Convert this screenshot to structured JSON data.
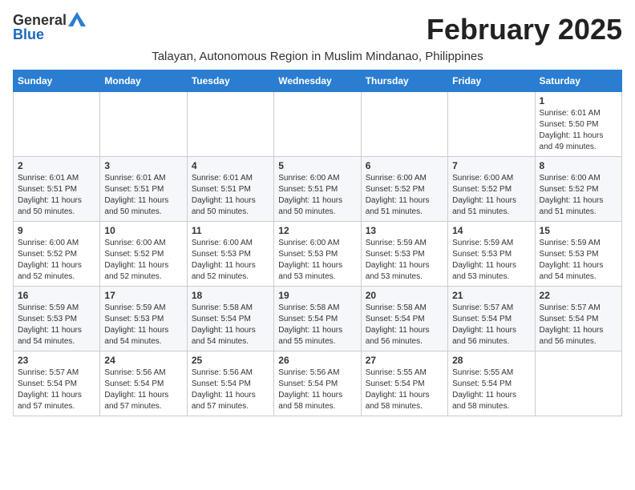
{
  "logo": {
    "general": "General",
    "blue": "Blue"
  },
  "title": "February 2025",
  "subtitle": "Talayan, Autonomous Region in Muslim Mindanao, Philippines",
  "days_of_week": [
    "Sunday",
    "Monday",
    "Tuesday",
    "Wednesday",
    "Thursday",
    "Friday",
    "Saturday"
  ],
  "weeks": [
    [
      {
        "day": "",
        "info": ""
      },
      {
        "day": "",
        "info": ""
      },
      {
        "day": "",
        "info": ""
      },
      {
        "day": "",
        "info": ""
      },
      {
        "day": "",
        "info": ""
      },
      {
        "day": "",
        "info": ""
      },
      {
        "day": "1",
        "info": "Sunrise: 6:01 AM\nSunset: 5:50 PM\nDaylight: 11 hours and 49 minutes."
      }
    ],
    [
      {
        "day": "2",
        "info": "Sunrise: 6:01 AM\nSunset: 5:51 PM\nDaylight: 11 hours and 50 minutes."
      },
      {
        "day": "3",
        "info": "Sunrise: 6:01 AM\nSunset: 5:51 PM\nDaylight: 11 hours and 50 minutes."
      },
      {
        "day": "4",
        "info": "Sunrise: 6:01 AM\nSunset: 5:51 PM\nDaylight: 11 hours and 50 minutes."
      },
      {
        "day": "5",
        "info": "Sunrise: 6:00 AM\nSunset: 5:51 PM\nDaylight: 11 hours and 50 minutes."
      },
      {
        "day": "6",
        "info": "Sunrise: 6:00 AM\nSunset: 5:52 PM\nDaylight: 11 hours and 51 minutes."
      },
      {
        "day": "7",
        "info": "Sunrise: 6:00 AM\nSunset: 5:52 PM\nDaylight: 11 hours and 51 minutes."
      },
      {
        "day": "8",
        "info": "Sunrise: 6:00 AM\nSunset: 5:52 PM\nDaylight: 11 hours and 51 minutes."
      }
    ],
    [
      {
        "day": "9",
        "info": "Sunrise: 6:00 AM\nSunset: 5:52 PM\nDaylight: 11 hours and 52 minutes."
      },
      {
        "day": "10",
        "info": "Sunrise: 6:00 AM\nSunset: 5:52 PM\nDaylight: 11 hours and 52 minutes."
      },
      {
        "day": "11",
        "info": "Sunrise: 6:00 AM\nSunset: 5:53 PM\nDaylight: 11 hours and 52 minutes."
      },
      {
        "day": "12",
        "info": "Sunrise: 6:00 AM\nSunset: 5:53 PM\nDaylight: 11 hours and 53 minutes."
      },
      {
        "day": "13",
        "info": "Sunrise: 5:59 AM\nSunset: 5:53 PM\nDaylight: 11 hours and 53 minutes."
      },
      {
        "day": "14",
        "info": "Sunrise: 5:59 AM\nSunset: 5:53 PM\nDaylight: 11 hours and 53 minutes."
      },
      {
        "day": "15",
        "info": "Sunrise: 5:59 AM\nSunset: 5:53 PM\nDaylight: 11 hours and 54 minutes."
      }
    ],
    [
      {
        "day": "16",
        "info": "Sunrise: 5:59 AM\nSunset: 5:53 PM\nDaylight: 11 hours and 54 minutes."
      },
      {
        "day": "17",
        "info": "Sunrise: 5:59 AM\nSunset: 5:53 PM\nDaylight: 11 hours and 54 minutes."
      },
      {
        "day": "18",
        "info": "Sunrise: 5:58 AM\nSunset: 5:54 PM\nDaylight: 11 hours and 54 minutes."
      },
      {
        "day": "19",
        "info": "Sunrise: 5:58 AM\nSunset: 5:54 PM\nDaylight: 11 hours and 55 minutes."
      },
      {
        "day": "20",
        "info": "Sunrise: 5:58 AM\nSunset: 5:54 PM\nDaylight: 11 hours and 56 minutes."
      },
      {
        "day": "21",
        "info": "Sunrise: 5:57 AM\nSunset: 5:54 PM\nDaylight: 11 hours and 56 minutes."
      },
      {
        "day": "22",
        "info": "Sunrise: 5:57 AM\nSunset: 5:54 PM\nDaylight: 11 hours and 56 minutes."
      }
    ],
    [
      {
        "day": "23",
        "info": "Sunrise: 5:57 AM\nSunset: 5:54 PM\nDaylight: 11 hours and 57 minutes."
      },
      {
        "day": "24",
        "info": "Sunrise: 5:56 AM\nSunset: 5:54 PM\nDaylight: 11 hours and 57 minutes."
      },
      {
        "day": "25",
        "info": "Sunrise: 5:56 AM\nSunset: 5:54 PM\nDaylight: 11 hours and 57 minutes."
      },
      {
        "day": "26",
        "info": "Sunrise: 5:56 AM\nSunset: 5:54 PM\nDaylight: 11 hours and 58 minutes."
      },
      {
        "day": "27",
        "info": "Sunrise: 5:55 AM\nSunset: 5:54 PM\nDaylight: 11 hours and 58 minutes."
      },
      {
        "day": "28",
        "info": "Sunrise: 5:55 AM\nSunset: 5:54 PM\nDaylight: 11 hours and 58 minutes."
      },
      {
        "day": "",
        "info": ""
      }
    ]
  ]
}
